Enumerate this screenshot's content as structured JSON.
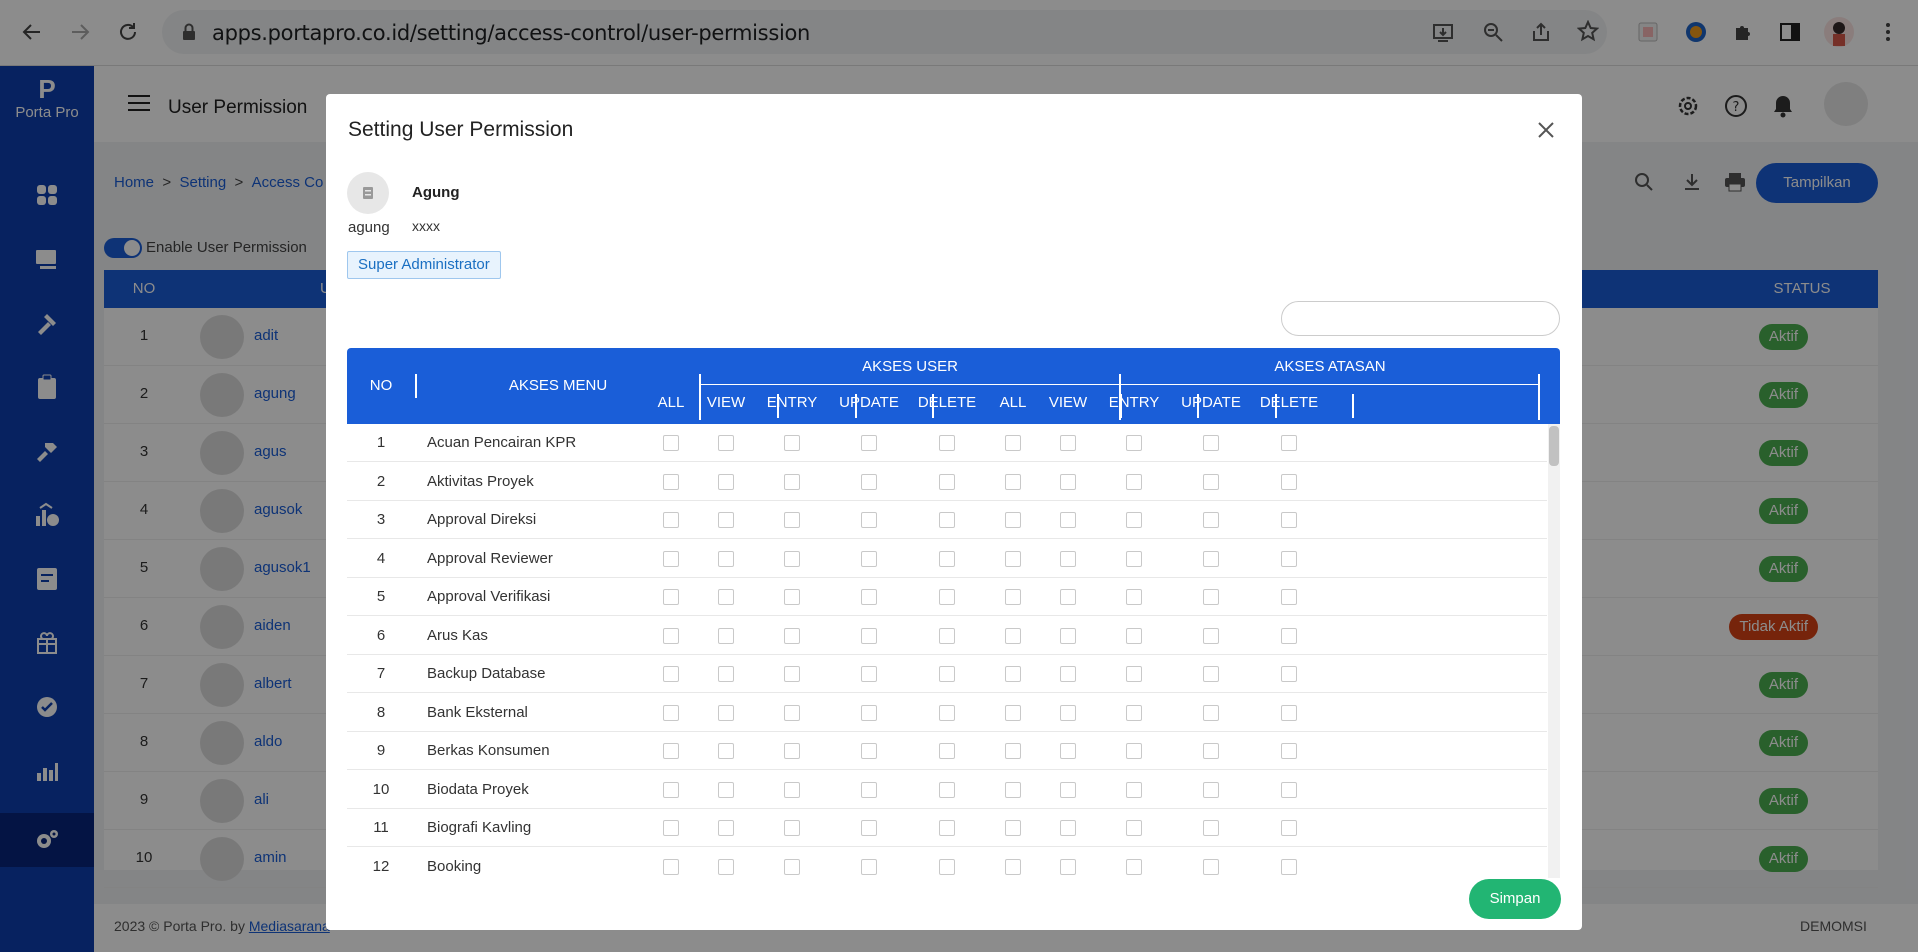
{
  "browser": {
    "url": "apps.portapro.co.id/setting/access-control/user-permission"
  },
  "app": {
    "logo_letter": "P",
    "logo_text": "Porta Pro",
    "page_title": "User Permission",
    "breadcrumb": {
      "home": "Home",
      "sep": ">",
      "setting": "Setting",
      "access": "Access Co"
    },
    "show_button": "Tampilkan",
    "enable_label": "Enable User Permission",
    "table_headers": {
      "no": "NO",
      "user": "U",
      "status": "STATUS"
    },
    "rows": [
      {
        "no": "1",
        "name": "adit",
        "status": "Aktif"
      },
      {
        "no": "2",
        "name": "agung",
        "status": "Aktif"
      },
      {
        "no": "3",
        "name": "agus",
        "status": "Aktif"
      },
      {
        "no": "4",
        "name": "agusok",
        "status": "Aktif"
      },
      {
        "no": "5",
        "name": "agusok1",
        "status": "Aktif"
      },
      {
        "no": "6",
        "name": "aiden",
        "status": "Tidak Aktif"
      },
      {
        "no": "7",
        "name": "albert",
        "status": "Aktif"
      },
      {
        "no": "8",
        "name": "aldo",
        "status": "Aktif"
      },
      {
        "no": "9",
        "name": "ali",
        "status": "Aktif"
      },
      {
        "no": "10",
        "name": "amin",
        "status": "Aktif"
      }
    ],
    "footer_left": "2023 © Porta Pro. by ",
    "footer_link": "Mediasarana",
    "footer_right": "DEMOMSI"
  },
  "colors": {
    "primary": "#1a5ed8",
    "sidebar": "#0d3faf",
    "active": "#22b573",
    "aktif_badge": "#4caf50",
    "inactive_badge": "#d84315"
  },
  "modal": {
    "title": "Setting User Permission",
    "user": {
      "name": "Agung",
      "login": "agung",
      "password": "xxxx",
      "role": "Super Administrator"
    },
    "search_placeholder": "",
    "headers": {
      "no": "NO",
      "menu": "AKSES MENU",
      "group_user": "AKSES USER",
      "group_atasan": "AKSES ATASAN",
      "cols": [
        "ALL",
        "VIEW",
        "ENTRY",
        "UPDATE",
        "DELETE",
        "ALL",
        "VIEW",
        "ENTRY",
        "UPDATE",
        "DELETE"
      ]
    },
    "menus": [
      {
        "no": "1",
        "name": "Acuan Pencairan KPR"
      },
      {
        "no": "2",
        "name": "Aktivitas Proyek"
      },
      {
        "no": "3",
        "name": "Approval Direksi"
      },
      {
        "no": "4",
        "name": "Approval Reviewer"
      },
      {
        "no": "5",
        "name": "Approval Verifikasi"
      },
      {
        "no": "6",
        "name": "Arus Kas"
      },
      {
        "no": "7",
        "name": "Backup Database"
      },
      {
        "no": "8",
        "name": "Bank Eksternal"
      },
      {
        "no": "9",
        "name": "Berkas Konsumen"
      },
      {
        "no": "10",
        "name": "Biodata Proyek"
      },
      {
        "no": "11",
        "name": "Biografi Kavling"
      },
      {
        "no": "12",
        "name": "Booking"
      }
    ],
    "save_button": "Simpan"
  }
}
